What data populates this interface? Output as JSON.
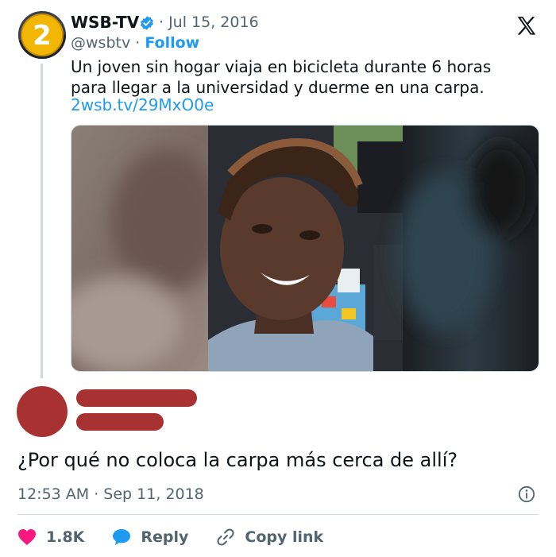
{
  "tweet": {
    "author_name": "WSB-TV",
    "date": "· Jul 15, 2016",
    "handle": "@wsbtv",
    "separator": "·",
    "follow_label": "Follow",
    "text_line1": "Un joven sin hogar viaja en bicicleta durante 6 horas",
    "text_line2": "para llegar a la universidad y duerme en una carpa.",
    "link": "2wsb.tv/29MxO0e",
    "logo_text": "2"
  },
  "reply": {
    "text": "¿Por qué no coloca la carpa más cerca de allí?",
    "timestamp": "12:53 AM · Sep 11, 2018"
  },
  "actions": {
    "likes": "1.8K",
    "reply_label": "Reply",
    "copy_link_label": "Copy link"
  },
  "icons": [
    "verified-badge-icon",
    "x-logo-icon",
    "info-icon",
    "heart-icon",
    "reply-bubble-icon",
    "link-icon"
  ],
  "colors": {
    "accent": "#1d9bf0",
    "text": "#0f1419",
    "secondary": "#536471",
    "redaction": "#a83232",
    "like": "#f91880"
  }
}
